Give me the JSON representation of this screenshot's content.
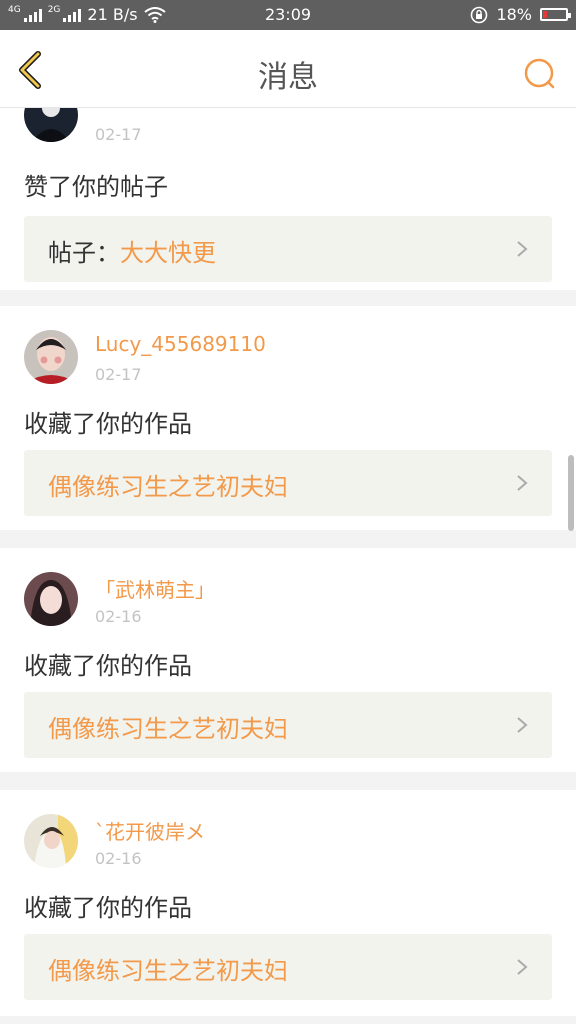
{
  "status_bar": {
    "network_left": "4G",
    "network_right": "2G",
    "speed": "21 B/s",
    "time": "23:09",
    "battery": "18%",
    "battery_level": 0.18,
    "battery_color": "#e53935"
  },
  "header": {
    "title": "消息",
    "back_icon": "chevron-left-icon",
    "search_icon": "search-icon",
    "accent_color": "#f2994a"
  },
  "notifications": [
    {
      "username": "",
      "date": "02-17",
      "action": "赞了你的帖子",
      "link_prefix": "帖子：",
      "link_text": "大大快更"
    },
    {
      "username": "Lucy_455689110",
      "date": "02-17",
      "action": "收藏了你的作品",
      "link_prefix": "",
      "link_text": "偶像练习生之艺初夫妇"
    },
    {
      "username": "「武林萌主」",
      "date": "02-16",
      "action": "收藏了你的作品",
      "link_prefix": "",
      "link_text": "偶像练习生之艺初夫妇"
    },
    {
      "username": "`花开彼岸メ",
      "date": "02-16",
      "action": "收藏了你的作品",
      "link_prefix": "",
      "link_text": "偶像练习生之艺初夫妇"
    }
  ]
}
